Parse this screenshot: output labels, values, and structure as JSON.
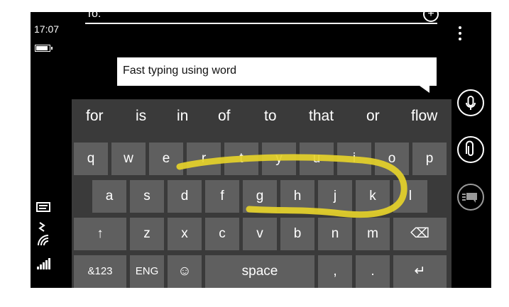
{
  "status": {
    "time": "17:07"
  },
  "header": {
    "to_label": "To:"
  },
  "compose": {
    "text": "Fast typing using word"
  },
  "suggestions": [
    "for",
    "is",
    "in",
    "of",
    "to",
    "that",
    "or",
    "flow"
  ],
  "keyboard": {
    "row1": [
      "q",
      "w",
      "e",
      "r",
      "t",
      "y",
      "u",
      "i",
      "o",
      "p"
    ],
    "row2": [
      "a",
      "s",
      "d",
      "f",
      "g",
      "h",
      "j",
      "k",
      "l"
    ],
    "row3": [
      "z",
      "x",
      "c",
      "v",
      "b",
      "n",
      "m"
    ],
    "shift_label": "↑",
    "backspace_label": "⌫",
    "numbers_label": "&123",
    "language_label": "ENG",
    "emoji_label": "☺",
    "space_label": "space",
    "comma_label": ",",
    "period_label": ".",
    "enter_label": "↵"
  },
  "side": {
    "mic_icon": "microphone-icon",
    "attach_icon": "paperclip-icon",
    "chat_icon": "message-icon"
  },
  "colors": {
    "key": "#5f5f5f",
    "keyboard_bg": "#3a3a3a",
    "swipe_trail": "#e6d32a"
  }
}
